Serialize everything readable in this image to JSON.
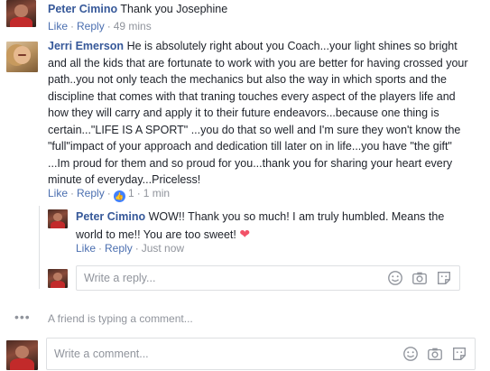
{
  "comment1": {
    "author": "Peter Cimino",
    "text": "Thank you Josephine",
    "like_label": "Like",
    "reply_label": "Reply",
    "timestamp": "49 mins"
  },
  "comment2": {
    "author": "Jerri Emerson",
    "text": "He is absolutely right about you Coach...your light shines so bright and all the kids that are fortunate to work with you are better for having crossed your path..you not only teach the mechanics but also the way in which sports and the discipline that comes with that traning touches every aspect of the players life and how they will carry and apply it to their future endeavors...because one thing is certain...\"LIFE IS A SPORT\" ...you do that so well and I'm sure they won't know the \"full\"impact of your approach and dedication till later on in life...you have \"the gift\" ...Im proud for them and so proud for you...thank you for sharing your heart every minute of everyday...Priceless!",
    "like_label": "Like",
    "reply_label": "Reply",
    "like_count": "1",
    "timestamp": "1 min"
  },
  "reply1": {
    "author": "Peter Cimino",
    "text": "WOW!! Thank you so much! I am truly humbled. Means the world to me!! You are too sweet!",
    "like_label": "Like",
    "reply_label": "Reply",
    "timestamp": "Just now"
  },
  "reply_input": {
    "placeholder": "Write a reply..."
  },
  "typing_indicator": {
    "dots": "•••",
    "text": "A friend is typing a comment..."
  },
  "comment_input": {
    "placeholder": "Write a comment..."
  },
  "colors": {
    "author_link": "#365899",
    "action_link": "#4b6fb0",
    "muted": "#90949c",
    "like_blue": "#4080ff",
    "heart": "#f25268"
  }
}
